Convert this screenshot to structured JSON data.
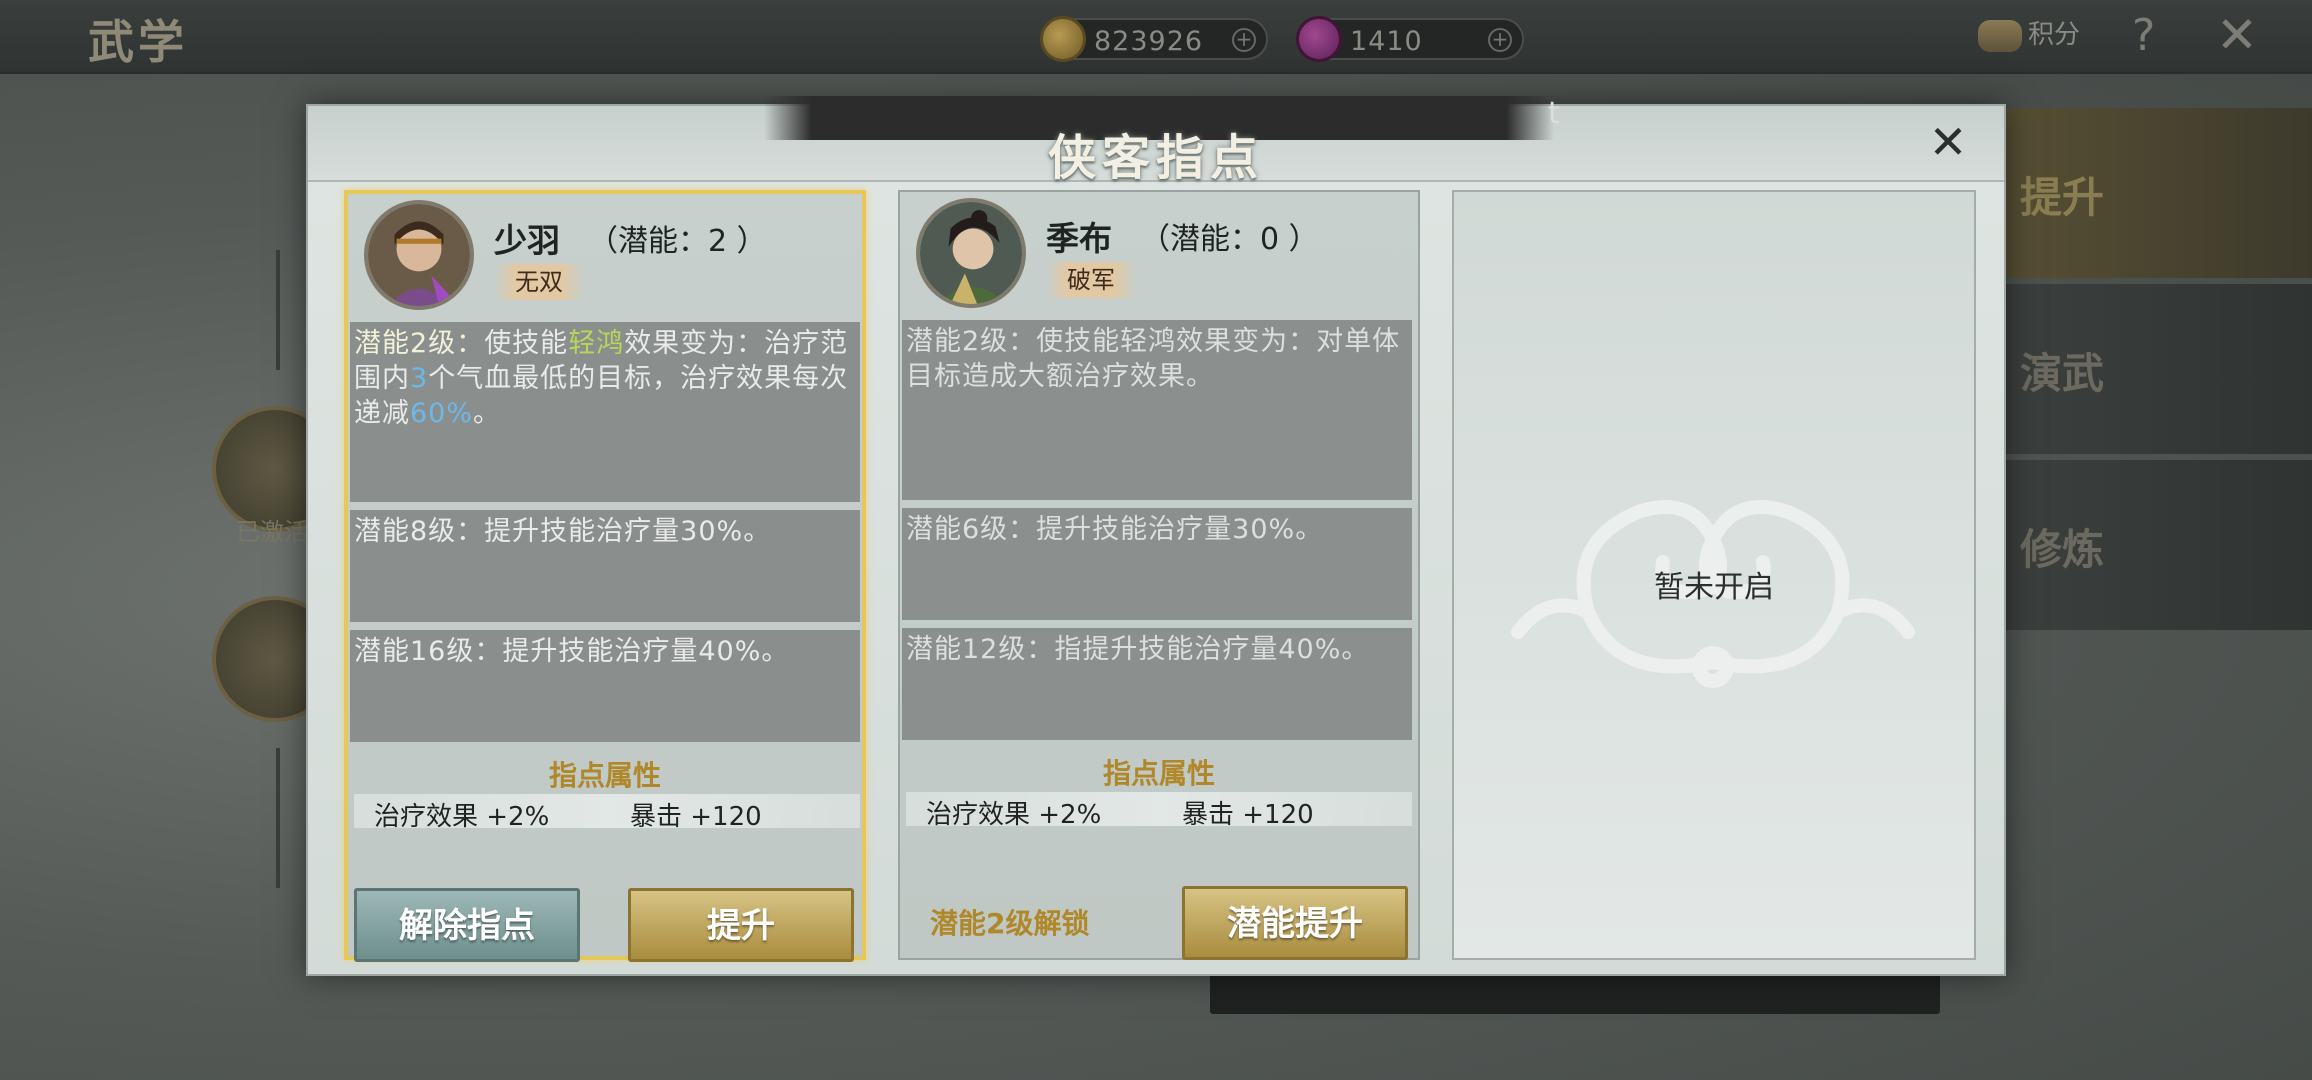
{
  "background": {
    "title": "武学",
    "currency": [
      {
        "icon": "coin-icon",
        "value": "823926"
      },
      {
        "icon": "gem-icon",
        "value": "1410"
      }
    ],
    "score_label": "积分",
    "help": "?",
    "close": "✕",
    "right_menu": [
      "提升",
      "演武",
      "修炼"
    ],
    "activated_label": "已激活"
  },
  "modal": {
    "title": "侠客指点",
    "close": "✕",
    "cards": [
      {
        "name": "少羽",
        "potential": "（潜能：2 ）",
        "tag": "无双",
        "selected": true,
        "potentials": [
          {
            "lvl": "潜能2级：",
            "pre": "使技能",
            "skill": "轻鸿",
            "mid1": "效果变为：治疗范围内",
            "num": "3",
            "mid2": "个气血最低的目标，治疗效果每次递减",
            "pct": "60%",
            "end": "。"
          },
          {
            "text": "潜能8级：提升技能治疗量30%。"
          },
          {
            "text": "潜能16级：提升技能治疗量40%。"
          }
        ],
        "attr_title": "指点属性",
        "attrs": [
          "治疗效果 +2%",
          "暴击 +120"
        ],
        "buttons": {
          "left": "解除指点",
          "right": "提升"
        }
      },
      {
        "name": "季布",
        "potential": "（潜能：0 ）",
        "tag": "破军",
        "selected": false,
        "potentials": [
          {
            "text": "潜能2级：使技能轻鸿效果变为：对单体目标造成大额治疗效果。"
          },
          {
            "text": "潜能6级：提升技能治疗量30%。"
          },
          {
            "text": "潜能12级：指提升技能治疗量40%。"
          }
        ],
        "attr_title": "指点属性",
        "attrs": [
          "治疗效果 +2%",
          "暴击 +120"
        ],
        "unlock_text": "潜能2级解锁",
        "buttons": {
          "right": "潜能提升"
        }
      }
    ],
    "locked_text": "暂未开启"
  },
  "colors": {
    "gold_text": "#b0882a",
    "highlight_green": "#b8d65a",
    "highlight_blue": "#6cb8e8",
    "selected_border": "#e5c75a"
  }
}
